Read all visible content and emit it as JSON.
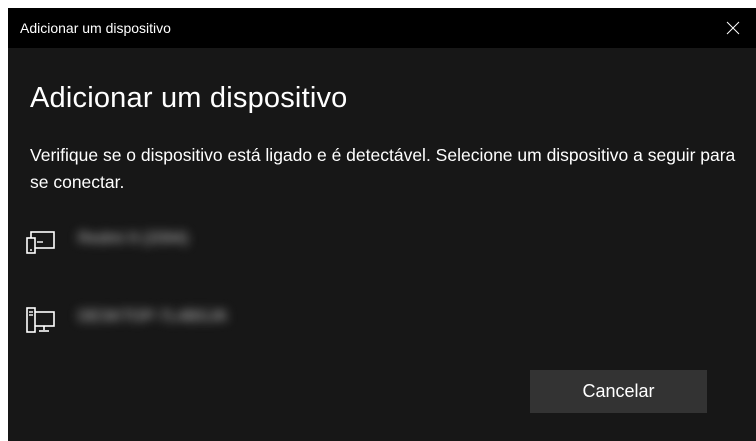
{
  "window": {
    "title": "Adicionar um dispositivo"
  },
  "heading": "Adicionar um dispositivo",
  "description": "Verifique se o dispositivo está ligado e é detectável. Selecione um dispositivo a seguir para se conectar.",
  "devices": [
    {
      "name": "Redmi 9 (2094)",
      "icon": "phone-icon"
    },
    {
      "name": "DESKTOP-7L4BGJK",
      "icon": "computer-icon"
    }
  ],
  "buttons": {
    "cancel": "Cancelar"
  },
  "colors": {
    "background": "#171717",
    "titlebar": "#000000",
    "button": "#333333",
    "text": "#ffffff"
  }
}
